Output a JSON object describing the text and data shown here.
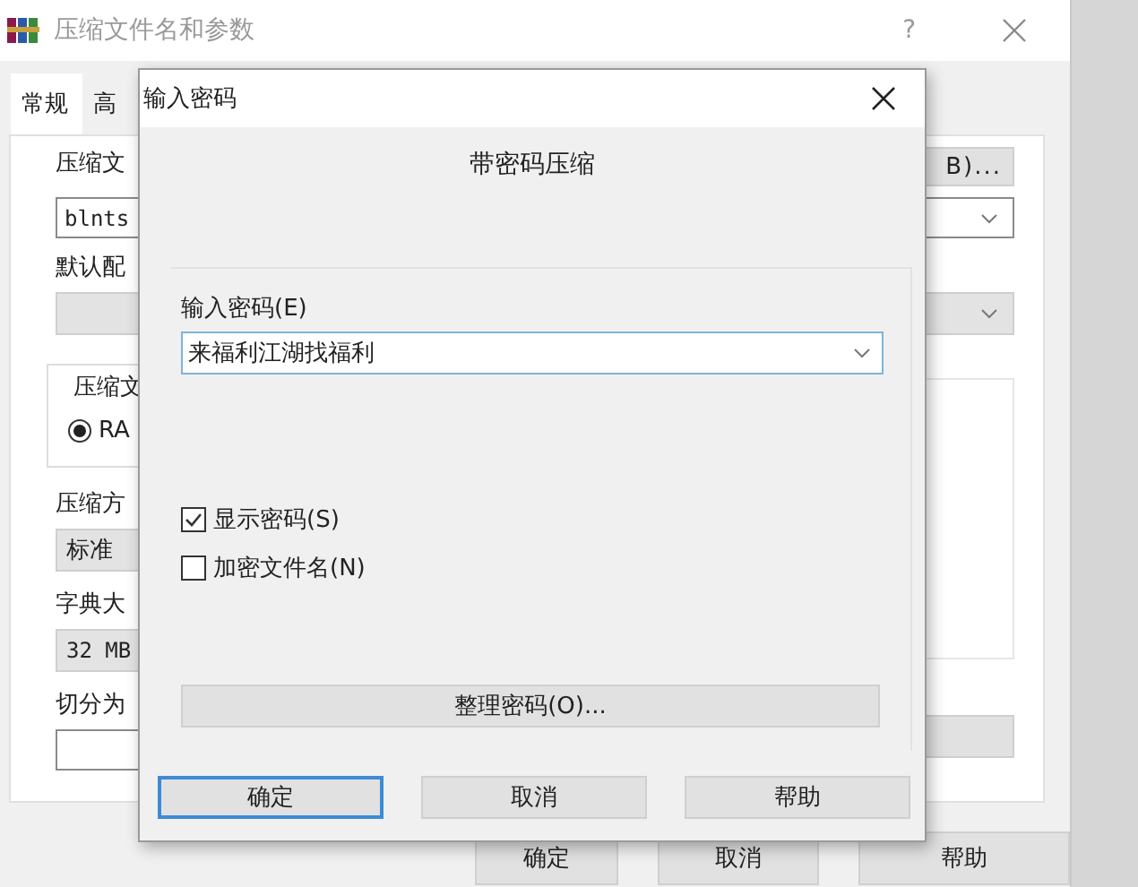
{
  "main_window": {
    "title": "压缩文件名和参数",
    "help_button": "?",
    "tabs": [
      {
        "label": "常规",
        "selected": true
      },
      {
        "label": "高",
        "selected": false
      }
    ],
    "archive_name_label": "压缩文",
    "browse_button": "B)...",
    "archive_name": "blnts",
    "profile_label": "默认配",
    "format_group_label": "压缩文",
    "format_option": {
      "label": "RA",
      "selected": true
    },
    "method_label": "压缩方",
    "method": "标准",
    "dictionary_label": "字典大",
    "dictionary": "32 MB",
    "split_label": "切分为",
    "buttons": [
      "确定",
      "取消",
      "帮助"
    ]
  },
  "password_dialog": {
    "title": "输入密码",
    "heading": "带密码压缩",
    "password_label": "输入密码(E)",
    "password": "来福利江湖找福利",
    "options": [
      {
        "label": "显示密码(S)",
        "checked": true
      },
      {
        "label": "加密文件名(N)",
        "checked": false
      }
    ],
    "organize_button": "整理密码(O)...",
    "buttons": [
      {
        "label": "确定",
        "default": true
      },
      {
        "label": "取消",
        "default": false
      },
      {
        "label": "帮助",
        "default": false
      }
    ]
  }
}
